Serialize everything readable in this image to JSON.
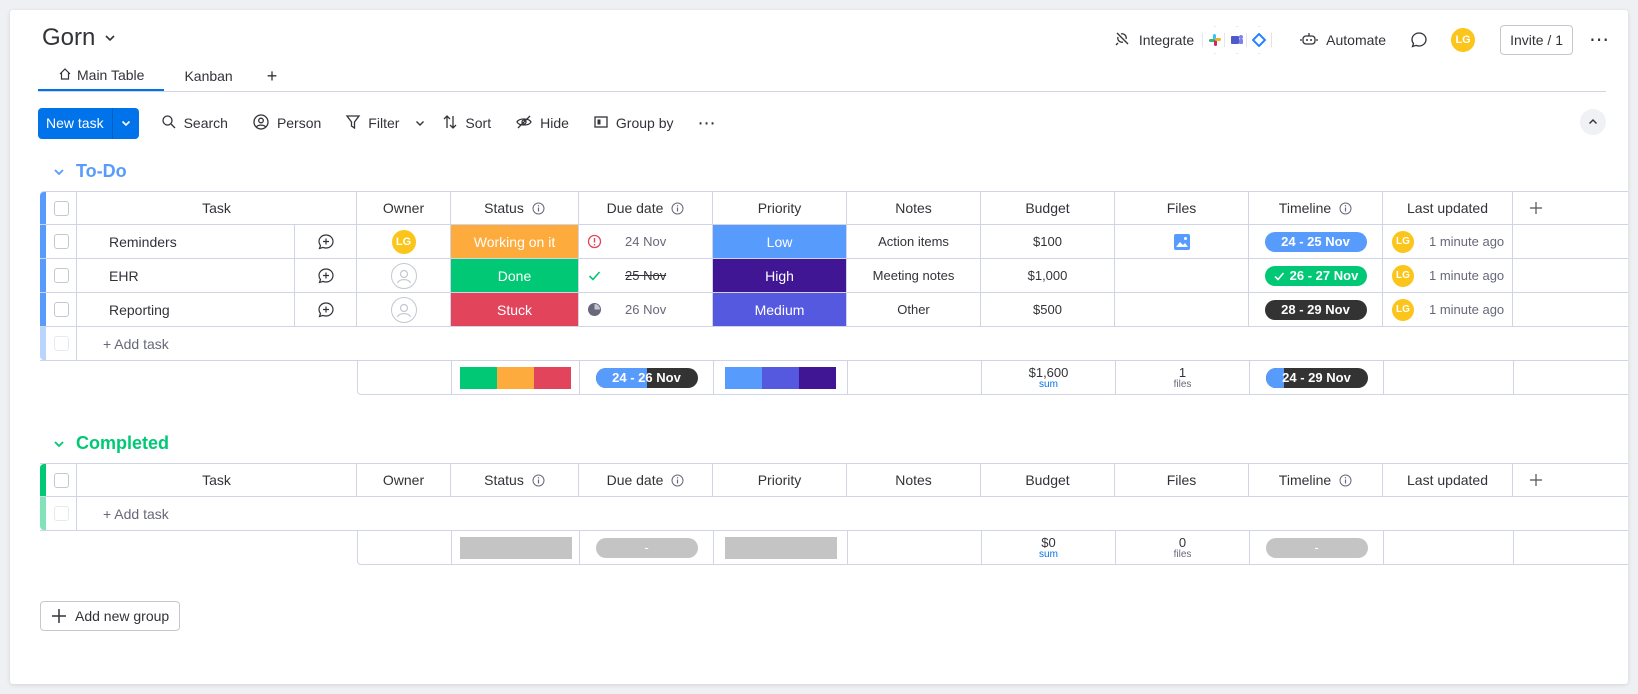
{
  "board": {
    "title": "Gorn"
  },
  "header": {
    "integrate_label": "Integrate",
    "automate_label": "Automate",
    "invite_label": "Invite / 1",
    "user_initials": "LG"
  },
  "tabs": [
    {
      "label": "Main Table",
      "icon": "home-icon",
      "active": true
    },
    {
      "label": "Kanban",
      "active": false
    }
  ],
  "toolbar": {
    "new_task": "New task",
    "search": "Search",
    "person": "Person",
    "filter": "Filter",
    "sort": "Sort",
    "hide": "Hide",
    "group_by": "Group by"
  },
  "columns": {
    "task": "Task",
    "owner": "Owner",
    "status": "Status",
    "due": "Due date",
    "priority": "Priority",
    "notes": "Notes",
    "budget": "Budget",
    "files": "Files",
    "timeline": "Timeline",
    "last_updated": "Last updated"
  },
  "colors": {
    "working": "#fdab3d",
    "done": "#00c875",
    "stuck": "#e2445c",
    "low": "#579bfc",
    "high": "#401694",
    "medium": "#5559df",
    "todo_group": "#579bfc",
    "completed_group": "#00c875",
    "accent": "#0073ea"
  },
  "groups": [
    {
      "title": "To-Do",
      "rows": [
        {
          "task": "Reminders",
          "owner": "LG",
          "status": "Working on it",
          "status_color": "#fdab3d",
          "due": "24 Nov",
          "due_icon": "alert-icon",
          "priority": "Low",
          "priority_color": "#579bfc",
          "notes": "Action items",
          "budget": "$100",
          "files": "image-file-icon",
          "timeline": "24 - 25 Nov",
          "timeline_color": "#579bfc",
          "last_updated_by": "LG",
          "last_updated": "1 minute ago"
        },
        {
          "task": "EHR",
          "owner": "",
          "status": "Done",
          "status_color": "#00c875",
          "due": "25 Nov",
          "due_icon": "check-icon",
          "priority": "High",
          "priority_color": "#401694",
          "notes": "Meeting notes",
          "budget": "$1,000",
          "files": "",
          "timeline": "26 - 27 Nov",
          "timeline_color": "#00c875",
          "last_updated_by": "LG",
          "last_updated": "1 minute ago"
        },
        {
          "task": "Reporting",
          "owner": "",
          "status": "Stuck",
          "status_color": "#e2445c",
          "due": "26 Nov",
          "due_icon": "clock-icon",
          "priority": "Medium",
          "priority_color": "#5559df",
          "notes": "Other",
          "budget": "$500",
          "files": "",
          "timeline": "28 - 29 Nov",
          "timeline_color": "#333333",
          "last_updated_by": "LG",
          "last_updated": "1 minute ago"
        }
      ],
      "add_task": "+ Add task",
      "summary": {
        "due": "24 - 26 Nov",
        "budget": "$1,600",
        "budget_label": "sum",
        "files": "1",
        "files_label": "files",
        "timeline": "24 - 29 Nov"
      }
    },
    {
      "title": "Completed",
      "rows": [],
      "add_task": "+ Add task",
      "summary": {
        "due": "-",
        "budget": "$0",
        "budget_label": "sum",
        "files": "0",
        "files_label": "files",
        "timeline": "-"
      }
    }
  ],
  "add_group": "Add new group"
}
